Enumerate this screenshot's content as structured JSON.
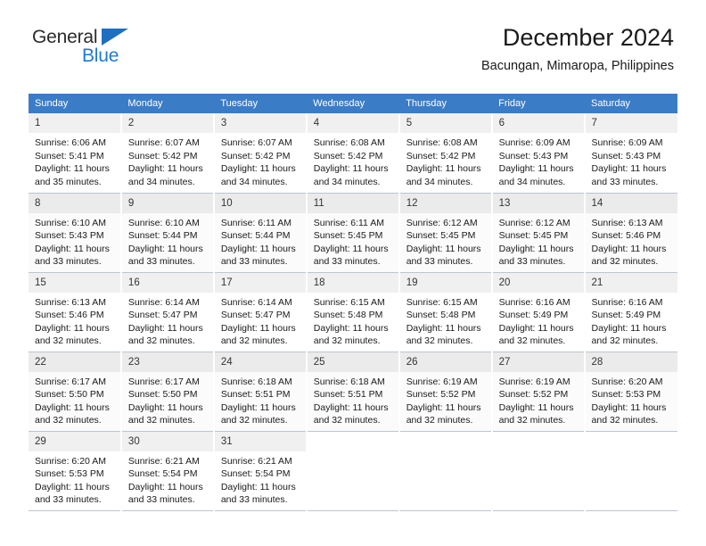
{
  "brand": {
    "line1": "General",
    "line2": "Blue",
    "triangle_color": "#1f6fc0",
    "line2_color": "#1f7ad1"
  },
  "header": {
    "title": "December 2024",
    "subtitle": "Bacungan, Mimaropa, Philippines"
  },
  "theme": {
    "header_bg": "#3b7cc7",
    "header_text": "#ffffff",
    "daynum_bg": "#f0f0f0",
    "grid_line": "#b9c6d4"
  },
  "weekday_headers": [
    "Sunday",
    "Monday",
    "Tuesday",
    "Wednesday",
    "Thursday",
    "Friday",
    "Saturday"
  ],
  "weeks": [
    {
      "days": [
        {
          "date": "1",
          "sunrise": "Sunrise: 6:06 AM",
          "sunset": "Sunset: 5:41 PM",
          "daylight1": "Daylight: 11 hours",
          "daylight2": "and 35 minutes."
        },
        {
          "date": "2",
          "sunrise": "Sunrise: 6:07 AM",
          "sunset": "Sunset: 5:42 PM",
          "daylight1": "Daylight: 11 hours",
          "daylight2": "and 34 minutes."
        },
        {
          "date": "3",
          "sunrise": "Sunrise: 6:07 AM",
          "sunset": "Sunset: 5:42 PM",
          "daylight1": "Daylight: 11 hours",
          "daylight2": "and 34 minutes."
        },
        {
          "date": "4",
          "sunrise": "Sunrise: 6:08 AM",
          "sunset": "Sunset: 5:42 PM",
          "daylight1": "Daylight: 11 hours",
          "daylight2": "and 34 minutes."
        },
        {
          "date": "5",
          "sunrise": "Sunrise: 6:08 AM",
          "sunset": "Sunset: 5:42 PM",
          "daylight1": "Daylight: 11 hours",
          "daylight2": "and 34 minutes."
        },
        {
          "date": "6",
          "sunrise": "Sunrise: 6:09 AM",
          "sunset": "Sunset: 5:43 PM",
          "daylight1": "Daylight: 11 hours",
          "daylight2": "and 34 minutes."
        },
        {
          "date": "7",
          "sunrise": "Sunrise: 6:09 AM",
          "sunset": "Sunset: 5:43 PM",
          "daylight1": "Daylight: 11 hours",
          "daylight2": "and 33 minutes."
        }
      ]
    },
    {
      "days": [
        {
          "date": "8",
          "sunrise": "Sunrise: 6:10 AM",
          "sunset": "Sunset: 5:43 PM",
          "daylight1": "Daylight: 11 hours",
          "daylight2": "and 33 minutes."
        },
        {
          "date": "9",
          "sunrise": "Sunrise: 6:10 AM",
          "sunset": "Sunset: 5:44 PM",
          "daylight1": "Daylight: 11 hours",
          "daylight2": "and 33 minutes."
        },
        {
          "date": "10",
          "sunrise": "Sunrise: 6:11 AM",
          "sunset": "Sunset: 5:44 PM",
          "daylight1": "Daylight: 11 hours",
          "daylight2": "and 33 minutes."
        },
        {
          "date": "11",
          "sunrise": "Sunrise: 6:11 AM",
          "sunset": "Sunset: 5:45 PM",
          "daylight1": "Daylight: 11 hours",
          "daylight2": "and 33 minutes."
        },
        {
          "date": "12",
          "sunrise": "Sunrise: 6:12 AM",
          "sunset": "Sunset: 5:45 PM",
          "daylight1": "Daylight: 11 hours",
          "daylight2": "and 33 minutes."
        },
        {
          "date": "13",
          "sunrise": "Sunrise: 6:12 AM",
          "sunset": "Sunset: 5:45 PM",
          "daylight1": "Daylight: 11 hours",
          "daylight2": "and 33 minutes."
        },
        {
          "date": "14",
          "sunrise": "Sunrise: 6:13 AM",
          "sunset": "Sunset: 5:46 PM",
          "daylight1": "Daylight: 11 hours",
          "daylight2": "and 32 minutes."
        }
      ]
    },
    {
      "days": [
        {
          "date": "15",
          "sunrise": "Sunrise: 6:13 AM",
          "sunset": "Sunset: 5:46 PM",
          "daylight1": "Daylight: 11 hours",
          "daylight2": "and 32 minutes."
        },
        {
          "date": "16",
          "sunrise": "Sunrise: 6:14 AM",
          "sunset": "Sunset: 5:47 PM",
          "daylight1": "Daylight: 11 hours",
          "daylight2": "and 32 minutes."
        },
        {
          "date": "17",
          "sunrise": "Sunrise: 6:14 AM",
          "sunset": "Sunset: 5:47 PM",
          "daylight1": "Daylight: 11 hours",
          "daylight2": "and 32 minutes."
        },
        {
          "date": "18",
          "sunrise": "Sunrise: 6:15 AM",
          "sunset": "Sunset: 5:48 PM",
          "daylight1": "Daylight: 11 hours",
          "daylight2": "and 32 minutes."
        },
        {
          "date": "19",
          "sunrise": "Sunrise: 6:15 AM",
          "sunset": "Sunset: 5:48 PM",
          "daylight1": "Daylight: 11 hours",
          "daylight2": "and 32 minutes."
        },
        {
          "date": "20",
          "sunrise": "Sunrise: 6:16 AM",
          "sunset": "Sunset: 5:49 PM",
          "daylight1": "Daylight: 11 hours",
          "daylight2": "and 32 minutes."
        },
        {
          "date": "21",
          "sunrise": "Sunrise: 6:16 AM",
          "sunset": "Sunset: 5:49 PM",
          "daylight1": "Daylight: 11 hours",
          "daylight2": "and 32 minutes."
        }
      ]
    },
    {
      "days": [
        {
          "date": "22",
          "sunrise": "Sunrise: 6:17 AM",
          "sunset": "Sunset: 5:50 PM",
          "daylight1": "Daylight: 11 hours",
          "daylight2": "and 32 minutes."
        },
        {
          "date": "23",
          "sunrise": "Sunrise: 6:17 AM",
          "sunset": "Sunset: 5:50 PM",
          "daylight1": "Daylight: 11 hours",
          "daylight2": "and 32 minutes."
        },
        {
          "date": "24",
          "sunrise": "Sunrise: 6:18 AM",
          "sunset": "Sunset: 5:51 PM",
          "daylight1": "Daylight: 11 hours",
          "daylight2": "and 32 minutes."
        },
        {
          "date": "25",
          "sunrise": "Sunrise: 6:18 AM",
          "sunset": "Sunset: 5:51 PM",
          "daylight1": "Daylight: 11 hours",
          "daylight2": "and 32 minutes."
        },
        {
          "date": "26",
          "sunrise": "Sunrise: 6:19 AM",
          "sunset": "Sunset: 5:52 PM",
          "daylight1": "Daylight: 11 hours",
          "daylight2": "and 32 minutes."
        },
        {
          "date": "27",
          "sunrise": "Sunrise: 6:19 AM",
          "sunset": "Sunset: 5:52 PM",
          "daylight1": "Daylight: 11 hours",
          "daylight2": "and 32 minutes."
        },
        {
          "date": "28",
          "sunrise": "Sunrise: 6:20 AM",
          "sunset": "Sunset: 5:53 PM",
          "daylight1": "Daylight: 11 hours",
          "daylight2": "and 32 minutes."
        }
      ]
    },
    {
      "days": [
        {
          "date": "29",
          "sunrise": "Sunrise: 6:20 AM",
          "sunset": "Sunset: 5:53 PM",
          "daylight1": "Daylight: 11 hours",
          "daylight2": "and 33 minutes."
        },
        {
          "date": "30",
          "sunrise": "Sunrise: 6:21 AM",
          "sunset": "Sunset: 5:54 PM",
          "daylight1": "Daylight: 11 hours",
          "daylight2": "and 33 minutes."
        },
        {
          "date": "31",
          "sunrise": "Sunrise: 6:21 AM",
          "sunset": "Sunset: 5:54 PM",
          "daylight1": "Daylight: 11 hours",
          "daylight2": "and 33 minutes."
        },
        {
          "date": "",
          "sunrise": "",
          "sunset": "",
          "daylight1": "",
          "daylight2": ""
        },
        {
          "date": "",
          "sunrise": "",
          "sunset": "",
          "daylight1": "",
          "daylight2": ""
        },
        {
          "date": "",
          "sunrise": "",
          "sunset": "",
          "daylight1": "",
          "daylight2": ""
        },
        {
          "date": "",
          "sunrise": "",
          "sunset": "",
          "daylight1": "",
          "daylight2": ""
        }
      ]
    }
  ]
}
